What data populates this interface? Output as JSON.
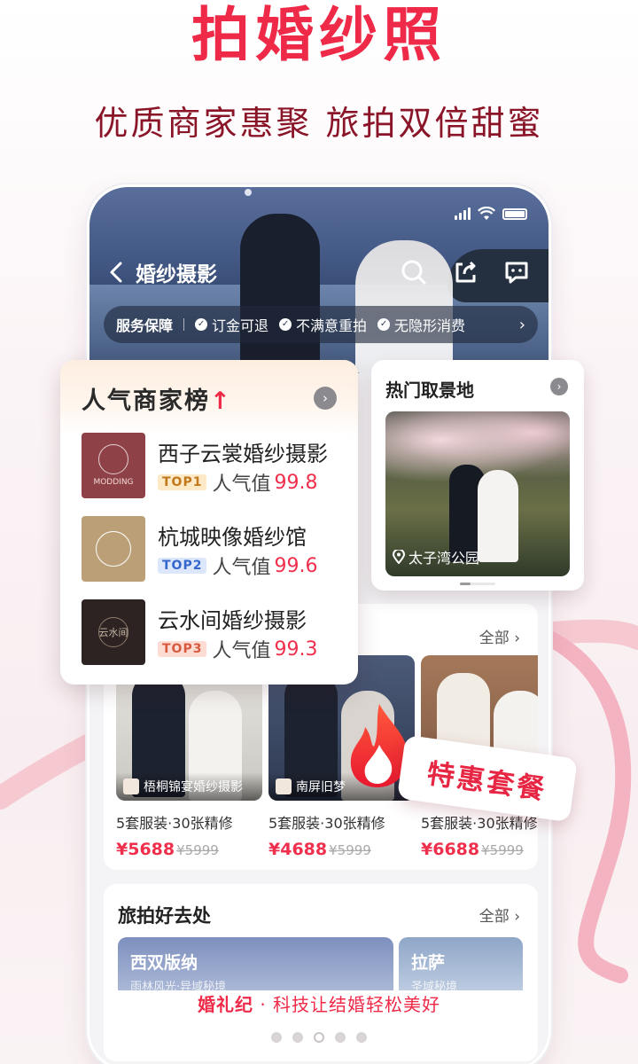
{
  "hero": {
    "title": "拍婚纱照",
    "subtitle": "优质商家惠聚 旅拍双倍甜蜜"
  },
  "phone": {
    "nav_title": "婚纱摄影",
    "icons": [
      "back-icon",
      "search-icon",
      "share-icon",
      "message-icon"
    ],
    "service_bar": {
      "title": "服务保障",
      "items": [
        "订金可退",
        "不满意重拍",
        "无隐形消费"
      ]
    },
    "packages": {
      "all_label": "全部",
      "items": [
        {
          "shop": "梧桐锦宴婚纱摄影",
          "desc": "5套服装·30张精修",
          "price": "¥5688",
          "orig": "¥5999"
        },
        {
          "shop": "南屏旧梦",
          "desc": "5套服装·30张精修",
          "price": "¥4688",
          "orig": "¥5999"
        },
        {
          "shop": "",
          "desc": "5套服装·30张精修",
          "price": "¥6688",
          "orig": "¥5999"
        }
      ]
    },
    "travel": {
      "title": "旅拍好去处",
      "all_label": "全部",
      "tiles": [
        {
          "name": "西双版纳",
          "sub": "雨林风光·异域秘境"
        },
        {
          "name": "拉萨",
          "sub": "圣域秘境"
        }
      ]
    }
  },
  "ranking": {
    "title_main": "人气商家榜",
    "items": [
      {
        "name": "西子云裳婚纱摄影",
        "badge": "TOP1",
        "label": "人气值",
        "value": "99.8",
        "logo_text": "MODDING"
      },
      {
        "name": "杭城映像婚纱馆",
        "badge": "TOP2",
        "label": "人气值",
        "value": "99.6",
        "logo_text": ""
      },
      {
        "name": "云水间婚纱摄影",
        "badge": "TOP3",
        "label": "人气值",
        "value": "99.3",
        "logo_text": "云水间"
      }
    ]
  },
  "locations": {
    "title": "热门取景地",
    "featured": "太子湾公园"
  },
  "deal": {
    "label": "特惠套餐"
  },
  "footer": {
    "brand": "婚礼纪",
    "dot": "·",
    "slogan": "科技让结婚轻松美好"
  },
  "colors": {
    "accent": "#ee2a48",
    "subtitle": "#8b1528",
    "price": "#ef2f4c"
  }
}
